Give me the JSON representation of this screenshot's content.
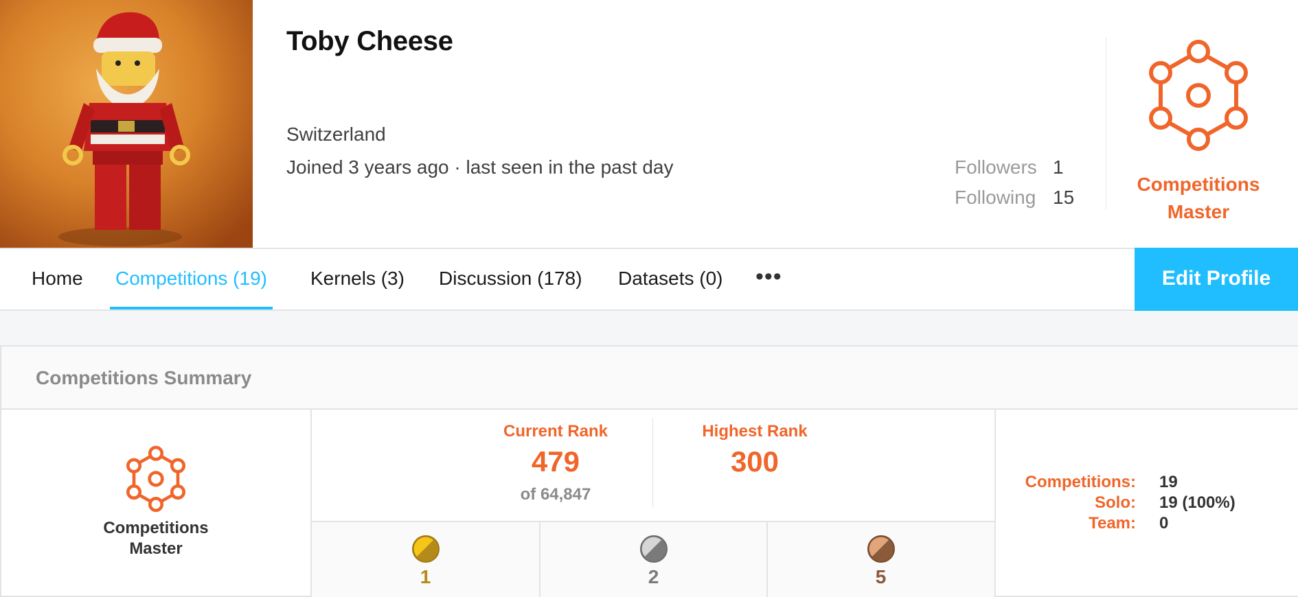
{
  "profile": {
    "name": "Toby Cheese",
    "location": "Switzerland",
    "joined": "Joined 3 years ago · last seen in the past day",
    "followers_label": "Followers",
    "followers_value": "1",
    "following_label": "Following",
    "following_value": "15",
    "tier_line1": "Competitions",
    "tier_line2": "Master"
  },
  "nav": {
    "tabs": [
      {
        "label": "Home"
      },
      {
        "label": "Competitions (19)"
      },
      {
        "label": "Kernels (3)"
      },
      {
        "label": "Discussion (178)"
      },
      {
        "label": "Datasets (0)"
      }
    ],
    "more": "•••",
    "edit_label": "Edit Profile"
  },
  "summary": {
    "title": "Competitions Summary",
    "tier_line1": "Competitions",
    "tier_line2": "Master",
    "current_rank_label": "Current Rank",
    "current_rank_value": "479",
    "current_rank_sub": "of 64,847",
    "highest_rank_label": "Highest Rank",
    "highest_rank_value": "300",
    "medals": [
      {
        "kind": "gold",
        "count": "1",
        "color": "#b48a1a"
      },
      {
        "kind": "silver",
        "count": "2",
        "color": "#7a7a7a"
      },
      {
        "kind": "bronze",
        "count": "5",
        "color": "#8b5a3a"
      }
    ],
    "stats": [
      {
        "label": "Competitions:",
        "value": "19"
      },
      {
        "label": "Solo:",
        "value": "19 (100%)"
      },
      {
        "label": "Team:",
        "value": "0"
      }
    ]
  },
  "colors": {
    "accent_orange": "#f0652a",
    "accent_blue": "#20beff"
  }
}
